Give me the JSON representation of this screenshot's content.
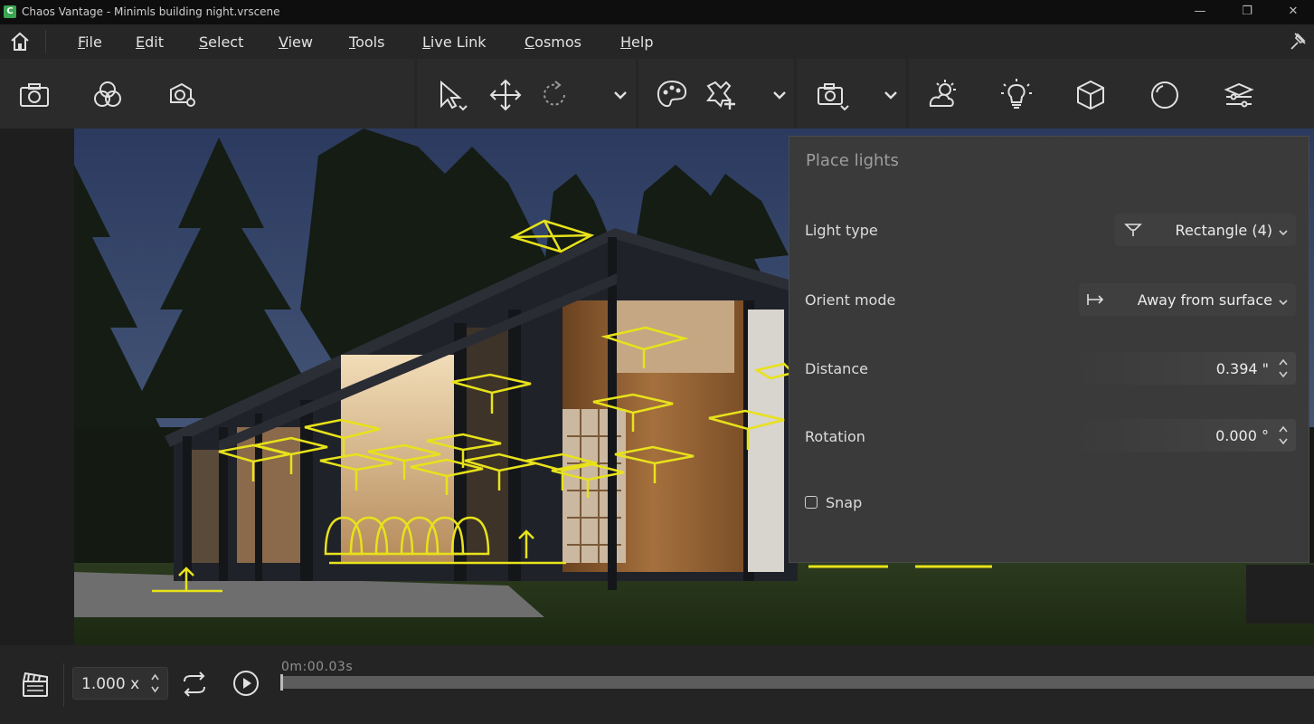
{
  "window": {
    "title": "Chaos Vantage - Minimls building night.vrscene",
    "logo_letter": "C",
    "minimize_glyph": "—",
    "maximize_glyph": "❐",
    "close_glyph": "✕"
  },
  "menu": {
    "items": [
      "File",
      "Edit",
      "Select",
      "View",
      "Tools",
      "Live Link",
      "Cosmos",
      "Help"
    ]
  },
  "toolbar": {
    "icons": [
      "camera-icon",
      "overlap-circles-icon",
      "camera-settings-icon",
      "select-arrow-icon",
      "move-icon",
      "rotate-icon",
      "chevron-down-icon",
      "material-palette-icon",
      "add-object-icon",
      "chevron-down-icon",
      "camera-view-icon",
      "chevron-down-icon",
      "sun-cloud-icon",
      "light-bulb-icon",
      "cube-icon",
      "sphere-icon",
      "layers-settings-icon"
    ]
  },
  "panel": {
    "title": "Place lights",
    "light_type_label": "Light type",
    "light_type_value": "Rectangle (4)",
    "orient_mode_label": "Orient mode",
    "orient_mode_value": "Away from surface",
    "distance_label": "Distance",
    "distance_value": "0.394 \"",
    "rotation_label": "Rotation",
    "rotation_value": "0.000 °",
    "snap_label": "Snap",
    "snap_checked": false
  },
  "playback": {
    "speed": "1.000 x",
    "time": "0m:00.03s",
    "progress": 0.0
  },
  "colors": {
    "gizmo": "#e8e21a",
    "panel_bg": "#3a3a3a",
    "app_bg": "#1c1c1c"
  }
}
